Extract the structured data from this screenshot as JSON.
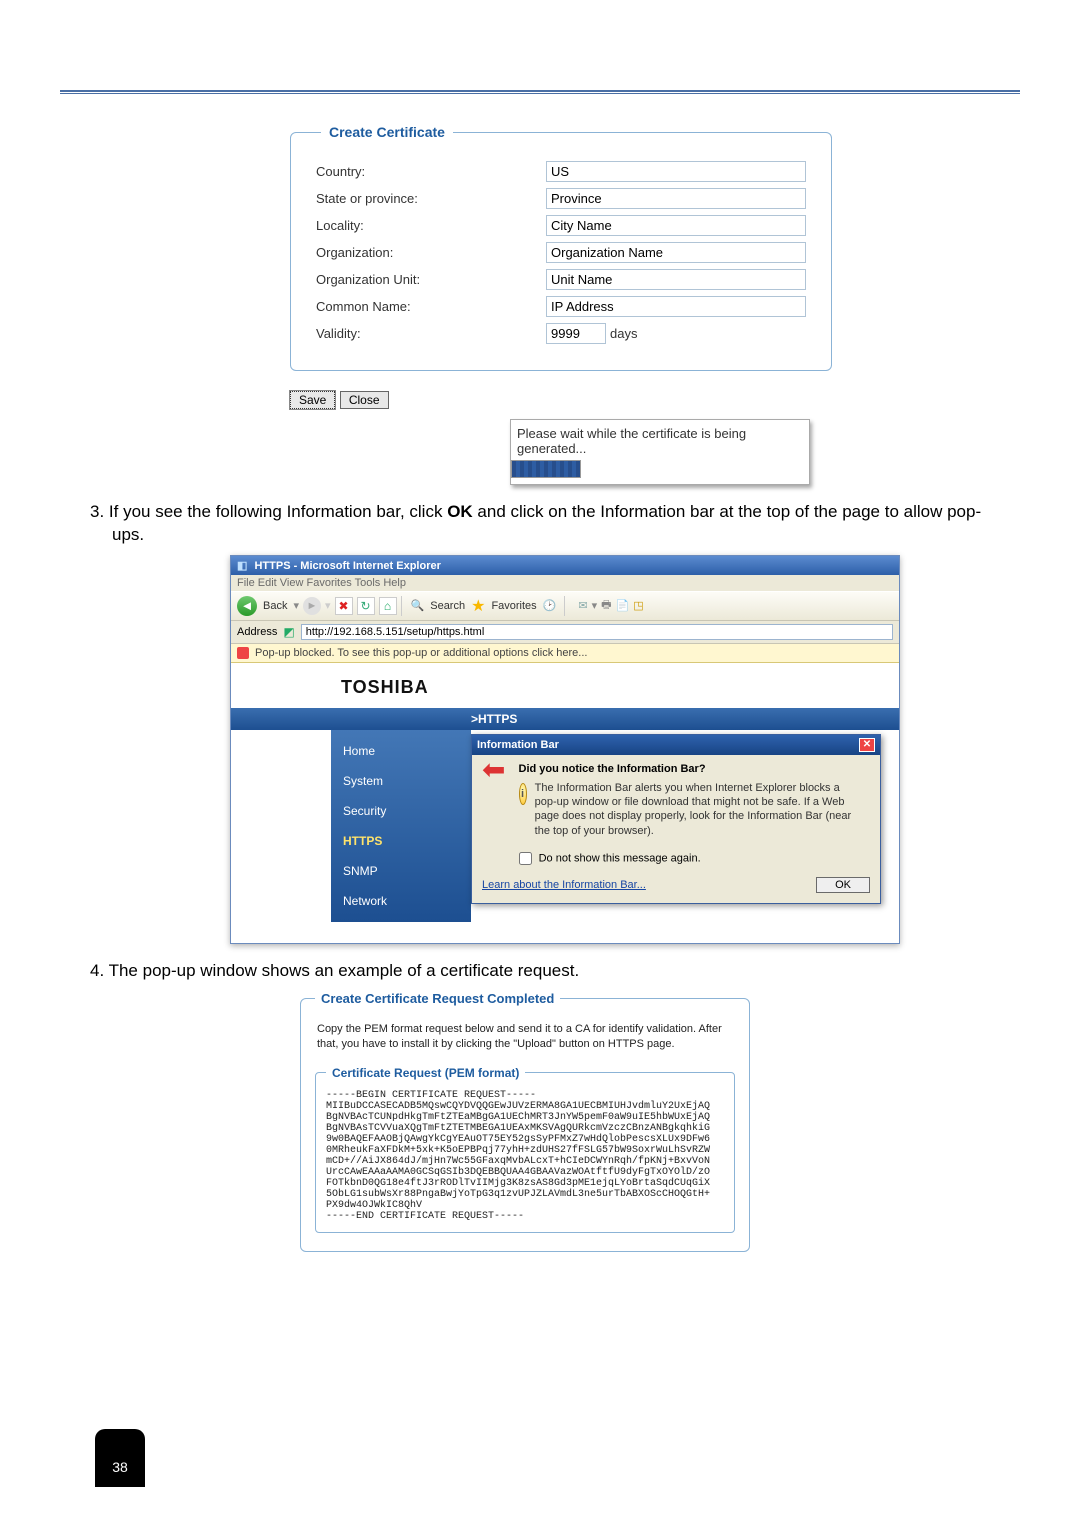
{
  "legend": {
    "createCert": "Create Certificate"
  },
  "form": {
    "country_label": "Country:",
    "country_value": "US",
    "state_label": "State or province:",
    "state_value": "Province",
    "locality_label": "Locality:",
    "locality_value": "City Name",
    "org_label": "Organization:",
    "org_value": "Organization Name",
    "ounit_label": "Organization Unit:",
    "ounit_value": "Unit Name",
    "common_label": "Common Name:",
    "common_value": "IP Address",
    "validity_label": "Validity:",
    "validity_value": "9999",
    "days": "days",
    "save": "Save",
    "close": "Close",
    "progress_text": "Please wait while the certificate is being generated..."
  },
  "step3": "3. If you see the following Information bar, click OK and click on the Information bar at the top of the page to allow pop-ups.",
  "ie": {
    "title": "HTTPS - Microsoft Internet Explorer",
    "menu": "File   Edit   View   Favorites   Tools   Help",
    "back": "Back",
    "search": "Search",
    "favorites": "Favorites",
    "address_label": "Address",
    "address_value": "http://192.168.5.151/setup/https.html",
    "infobar_text": "Pop-up blocked. To see this pop-up or additional options click here...",
    "brand": "TOSHIBA",
    "strip": ">HTTPS",
    "menu_items": [
      "Home",
      "System",
      "Security",
      "HTTPS",
      "SNMP",
      "Network"
    ],
    "dialog": {
      "title": "Information Bar",
      "q": "Did you notice the Information Bar?",
      "body": "The Information Bar alerts you when Internet Explorer blocks a pop-up window or file download that might not be safe. If a Web page does not display properly, look for the Information Bar (near the top of your browser).",
      "dontshow": "Do not show this message again.",
      "learn": "Learn about the Information Bar...",
      "ok": "OK"
    }
  },
  "step4": "4. The pop-up window shows an example of a certificate request.",
  "pem": {
    "legend": "Create Certificate Request Completed",
    "intro": "Copy the PEM format request below and send it to a CA for identify validation. After that, you have to install it by clicking the \"Upload\" button on HTTPS page.",
    "inner_legend": "Certificate Request (PEM format)",
    "text": "-----BEGIN CERTIFICATE REQUEST-----\nMIIBuDCCASECADB5MQswCQYDVQQGEwJUVzERMA8GA1UECBMIUHJvdmluY2UxEjAQ\nBgNVBAcTCUNpdHkgTmFtZTEaMBgGA1UEChMRT3JnYW5pemF0aW9uIE5hbWUxEjAQ\nBgNVBAsTCVVuaXQgTmFtZTETMBEGA1UEAxMKSVAgQURkcmVzczCBnzANBgkqhkiG\n9w0BAQEFAAOBjQAwgYkCgYEAuOT75EY52gsSyPFMxZ7wHdQlobPescsXLUx9DFw6\n0MRheukFaXFDkM+5xk+K5oEPBPqj77yhH+zdUHS27fFSLG57bW9SoxrWuLhSvRZW\nmCD+//AiJX864dJ/mjHn7Wc55GFaxqMvbALcxT+hCIeDCWYnRqh/fpKNj+BxvVoN\nUrcCAwEAAaAAMA0GCSqGSIb3DQEBBQUAA4GBAAVazWOAtftfU9dyFgTxOYOlD/zO\nFOTkbnD0QG18e4ftJ3rRODlTvIIMjg3K8zsAS8Gd3pME1ejqLYoBrtaSqdCUqGiX\n5ObLG1subWsXr88PngaBwjYoTpG3q1zvUPJZLAVmdL3ne5urTbABXOScCHOQGtH+\nPX9dw4OJWkIC8QhV\n-----END CERTIFICATE REQUEST-----"
  },
  "page_number": "38"
}
